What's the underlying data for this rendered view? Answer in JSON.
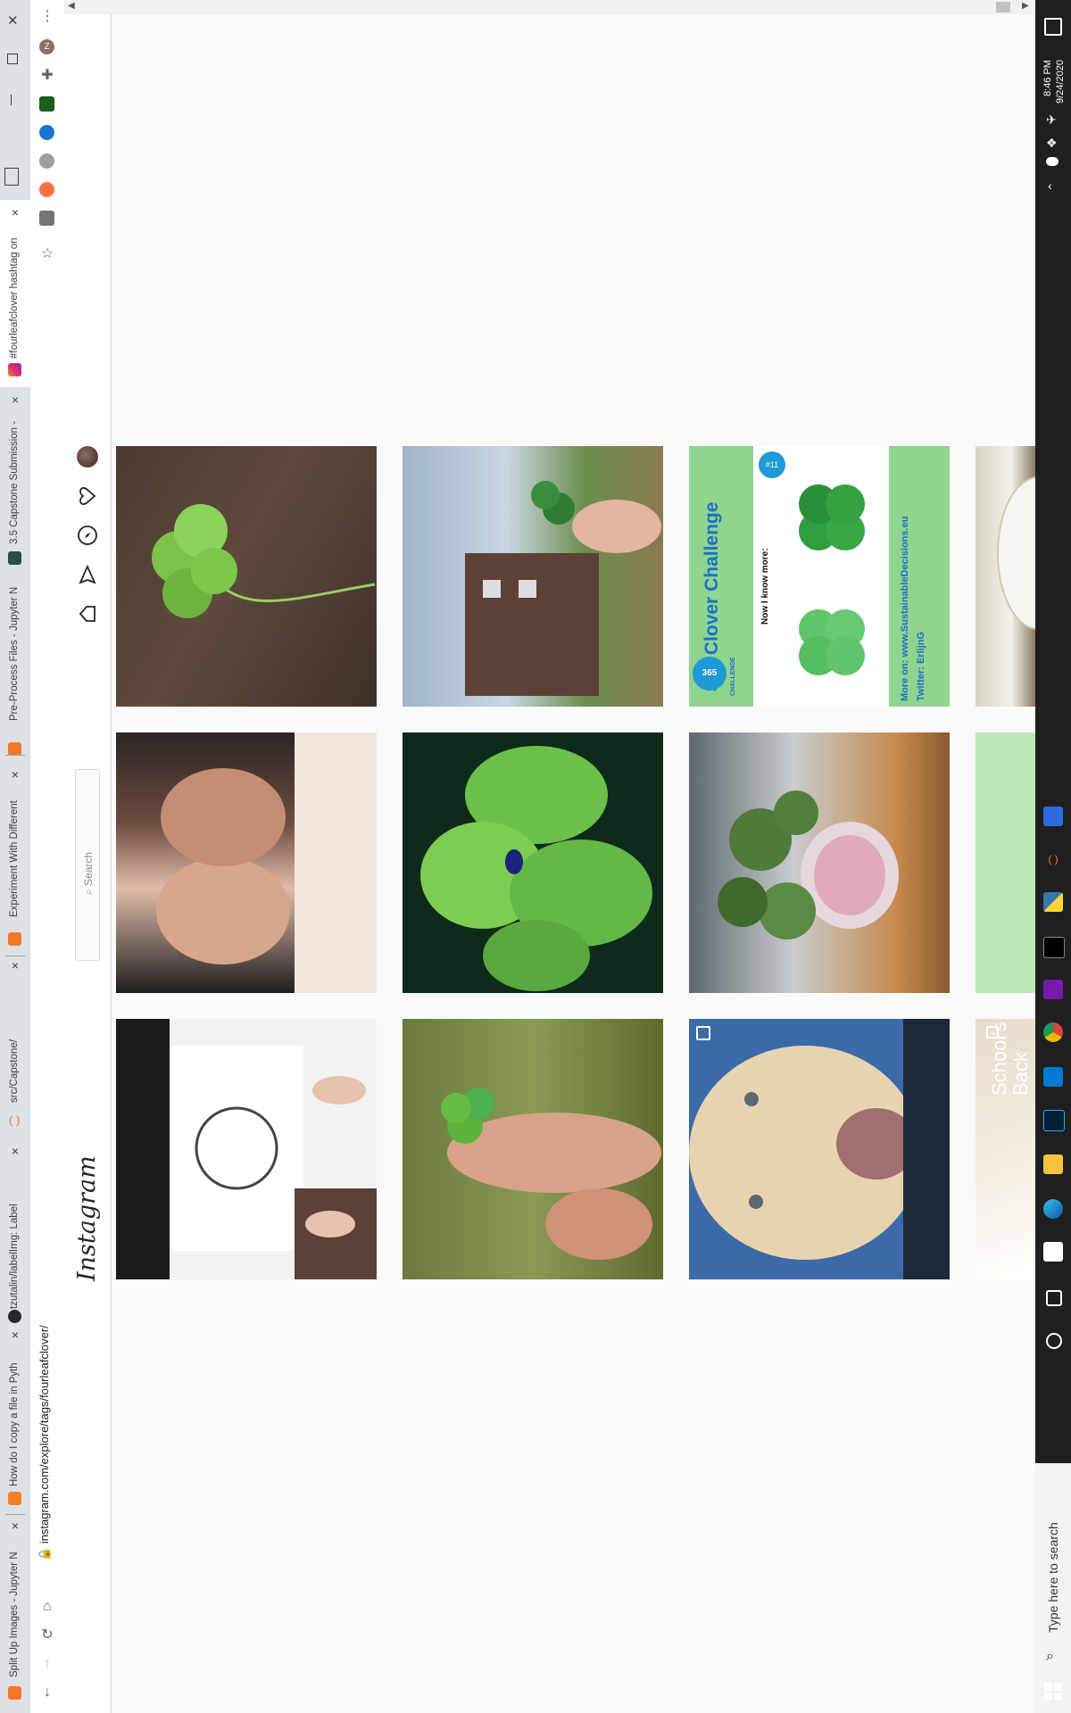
{
  "browser": {
    "tabs": [
      {
        "title": "Split Up Images - Jupyter N",
        "active": false
      },
      {
        "title": "How do I copy a file in Pyth",
        "active": false
      },
      {
        "title": "tzutalin/labelImg: Label",
        "active": false
      },
      {
        "title": "src/Capstone/",
        "active": false
      },
      {
        "title": "Experiment With Different",
        "active": false
      },
      {
        "title": "Pre-Process Files - Jupyter N",
        "active": false
      },
      {
        "title": "3.5 Capstone Submission -",
        "active": false
      },
      {
        "title": "#fourleafclover hashtag on",
        "active": true
      }
    ],
    "address": "instagram.com/explore/tags/fourleafclover/",
    "profile_initial": "Z"
  },
  "instagram": {
    "logo": "Instagram",
    "search_placeholder": "Search"
  },
  "posts": {
    "p2_title": "365 Clover Challenge",
    "p2_sub": "Now I know more:",
    "p2_link": "More on: www.SustainableDecisions.eu",
    "p2_twitter": "Twitter: ErlijnG",
    "p2_badge": "365",
    "p2_badge_sub": "CHALLENGE",
    "p2_day": "#11",
    "p3_text1": "School's",
    "p3_text2": "Back"
  },
  "taskbar": {
    "time": "8:46 PM",
    "date": "9/24/2020",
    "search_placeholder": "Type here to search"
  },
  "colors": {
    "taskbar": "#1f1f1f",
    "tabstrip": "#dee1e6",
    "clover_green": "#4caf50"
  }
}
